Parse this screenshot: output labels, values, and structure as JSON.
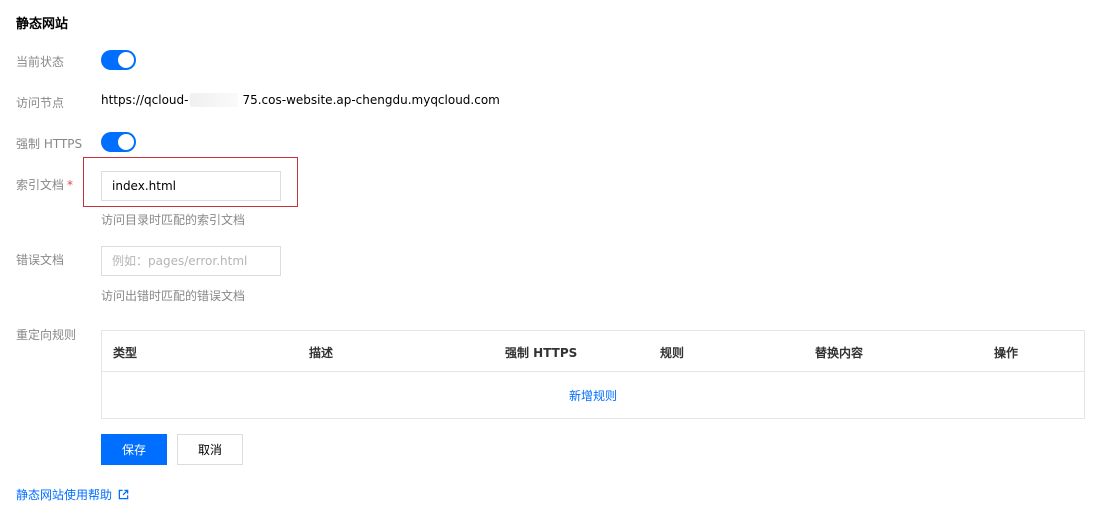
{
  "page": {
    "title": "静态网站"
  },
  "fields": {
    "status": {
      "label": "当前状态",
      "enabled": true
    },
    "endpoint": {
      "label": "访问节点",
      "url_prefix": "https://qcloud-",
      "url_suffix": "75.cos-website.ap-chengdu.myqcloud.com"
    },
    "force_https": {
      "label": "强制 HTTPS",
      "enabled": true
    },
    "index_doc": {
      "label": "索引文档",
      "required_mark": "*",
      "value": "index.html",
      "hint": "访问目录时匹配的索引文档"
    },
    "error_doc": {
      "label": "错误文档",
      "value": "",
      "placeholder": "例如：pages/error.html",
      "hint": "访问出错时匹配的错误文档"
    },
    "redirect_rules": {
      "label": "重定向规则",
      "columns": [
        "类型",
        "描述",
        "强制 HTTPS",
        "规则",
        "替换内容",
        "操作"
      ],
      "add_label": "新增规则"
    }
  },
  "actions": {
    "save_label": "保存",
    "cancel_label": "取消"
  },
  "help": {
    "label": "静态网站使用帮助",
    "icon": "external-link-icon"
  },
  "colors": {
    "primary": "#006eff",
    "highlight": "#c7323a",
    "required": "#e54545"
  }
}
